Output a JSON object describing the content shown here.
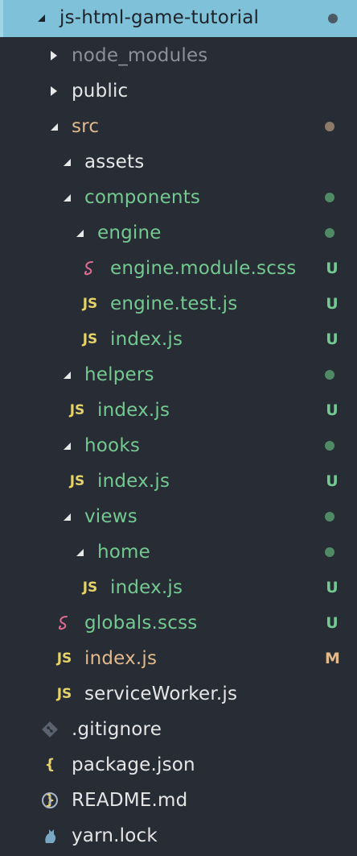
{
  "explorer": {
    "root": {
      "label": "js-html-game-tutorial"
    },
    "items": [
      {
        "label": "node_modules"
      },
      {
        "label": "public"
      },
      {
        "label": "src"
      },
      {
        "label": "assets"
      },
      {
        "label": "components"
      },
      {
        "label": "engine"
      },
      {
        "label": "engine.module.scss",
        "status": "U"
      },
      {
        "label": "engine.test.js",
        "status": "U"
      },
      {
        "label": "index.js",
        "status": "U"
      },
      {
        "label": "helpers"
      },
      {
        "label": "index.js",
        "status": "U"
      },
      {
        "label": "hooks"
      },
      {
        "label": "index.js",
        "status": "U"
      },
      {
        "label": "views"
      },
      {
        "label": "home"
      },
      {
        "label": "index.js",
        "status": "U"
      },
      {
        "label": "globals.scss",
        "status": "U"
      },
      {
        "label": "index.js",
        "status": "M"
      },
      {
        "label": "serviceWorker.js"
      },
      {
        "label": ".gitignore"
      },
      {
        "label": "package.json"
      },
      {
        "label": "README.md"
      },
      {
        "label": "yarn.lock"
      }
    ]
  },
  "icons": {
    "js": "JS",
    "json": "{ }"
  },
  "colors": {
    "selected_bg": "#7fc1d8",
    "panel_bg": "#282c34",
    "untracked": "#73c991",
    "modified": "#e0b98c",
    "ignored": "#8b9099"
  }
}
